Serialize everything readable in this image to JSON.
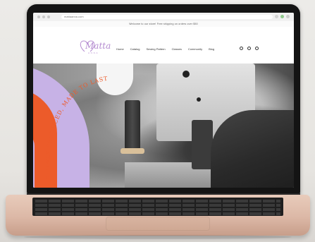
{
  "browser": {
    "url": "mattaanna.com"
  },
  "site": {
    "announcement": "Welcome to our store! Free shipping on orders over $50",
    "logo_text": "Matta",
    "logo_sub": "A N N A",
    "nav": [
      "Home",
      "Catalog",
      "Sewing Pattern",
      "Classes",
      "Community",
      "Blog"
    ],
    "hero_arc_text": "SLOWLY PRODUCED, MADE TO LAST"
  },
  "colors": {
    "accent_purple": "#c7b2e6",
    "accent_orange": "#ec5b2a",
    "logo_purple": "#b48bd0"
  }
}
